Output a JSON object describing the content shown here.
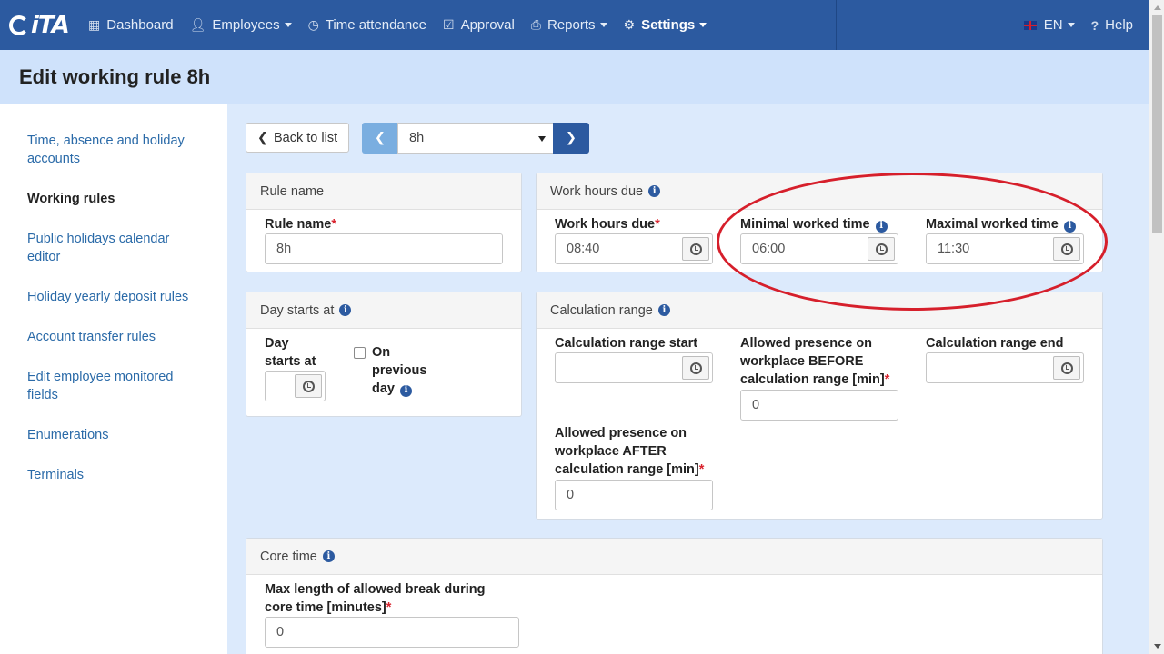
{
  "nav": {
    "brand": "iTA",
    "items": [
      {
        "label": "Dashboard",
        "icon": "grid-icon"
      },
      {
        "label": "Employees",
        "icon": "user-icon",
        "dropdown": true
      },
      {
        "label": "Time attendance",
        "icon": "clock-icon"
      },
      {
        "label": "Approval",
        "icon": "check-square-icon"
      },
      {
        "label": "Reports",
        "icon": "printer-icon",
        "dropdown": true
      },
      {
        "label": "Settings",
        "icon": "gear-icon",
        "dropdown": true,
        "active": true
      }
    ],
    "language": "EN",
    "help": "Help"
  },
  "page": {
    "title": "Edit working rule 8h"
  },
  "sidebar": {
    "items": [
      {
        "label": "Time, absence and holiday accounts"
      },
      {
        "label": "Working rules",
        "active": true
      },
      {
        "label": "Public holidays calendar editor"
      },
      {
        "label": "Holiday yearly deposit rules"
      },
      {
        "label": "Account transfer rules"
      },
      {
        "label": "Edit employee monitored fields"
      },
      {
        "label": "Enumerations"
      },
      {
        "label": "Terminals"
      }
    ]
  },
  "toolbar": {
    "back_label": "Back to list",
    "selected_rule": "8h"
  },
  "rule_name_panel": {
    "title": "Rule name",
    "label": "Rule name",
    "value": "8h"
  },
  "work_hours_panel": {
    "title": "Work hours due",
    "due_label": "Work hours due",
    "due_value": "08:40",
    "min_label": "Minimal worked time",
    "min_value": "06:00",
    "max_label": "Maximal worked time",
    "max_value": "11:30"
  },
  "day_start_panel": {
    "title": "Day starts at",
    "label_line1": "Day",
    "label_line2": "starts at",
    "value": "",
    "checkbox_line1": "On",
    "checkbox_line2": "previous",
    "checkbox_line3": "day"
  },
  "calc_range_panel": {
    "title": "Calculation range",
    "start_label": "Calculation range start",
    "start_value": "",
    "before_label_1": "Allowed presence on",
    "before_label_2": "workplace BEFORE",
    "before_label_3": "calculation range [min]",
    "before_value": "0",
    "end_label": "Calculation range end",
    "end_value": "",
    "after_label_1": "Allowed presence on",
    "after_label_2": "workplace AFTER",
    "after_label_3": "calculation range [min]",
    "after_value": "0"
  },
  "core_time_panel": {
    "title": "Core time",
    "break_label_1": "Max length of allowed break during",
    "break_label_2": "core time [minutes]",
    "break_value": "0"
  },
  "colors": {
    "navbar": "#2c5aa0",
    "header": "#cfe2fb",
    "content": "#dceafc",
    "link": "#2a6aa8",
    "annotation": "#d61f2b"
  }
}
